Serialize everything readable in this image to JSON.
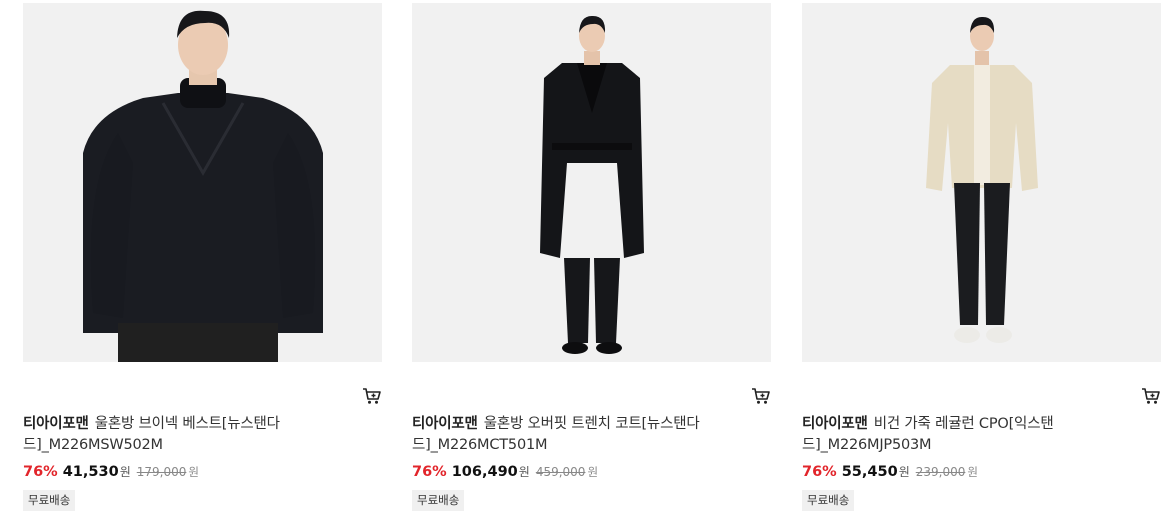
{
  "products": [
    {
      "image_icon": "model-in-black-v-neck-vest-photo",
      "brand": "티아이포맨",
      "name": "울혼방 브이넥 베스트[뉴스탠다드]_M226MSW502M",
      "discount": "76%",
      "sale_price": "41,530",
      "sale_unit": "원",
      "original_price": "179,000",
      "original_unit": "원",
      "badge": "무료배송",
      "cart_icon": "cart-icon"
    },
    {
      "image_icon": "model-in-black-trench-coat-photo",
      "brand": "티아이포맨",
      "name": "울혼방 오버핏 트렌치 코트[뉴스탠다드]_M226MCT501M",
      "discount": "76%",
      "sale_price": "106,490",
      "sale_unit": "원",
      "original_price": "459,000",
      "original_unit": "원",
      "badge": "무료배송",
      "cart_icon": "cart-icon"
    },
    {
      "image_icon": "model-in-beige-leather-shirt-photo",
      "brand": "티아이포맨",
      "name": "비건 가죽 레귤런 CPO[익스탠드]_M226MJP503M",
      "discount": "76%",
      "sale_price": "55,450",
      "sale_unit": "원",
      "original_price": "239,000",
      "original_unit": "원",
      "badge": "무료배송",
      "cart_icon": "cart-icon"
    }
  ],
  "colors": {
    "discount": "#e2252b",
    "badge_bg": "#f0f0f0",
    "photo_bg": "#f1f1f1"
  }
}
